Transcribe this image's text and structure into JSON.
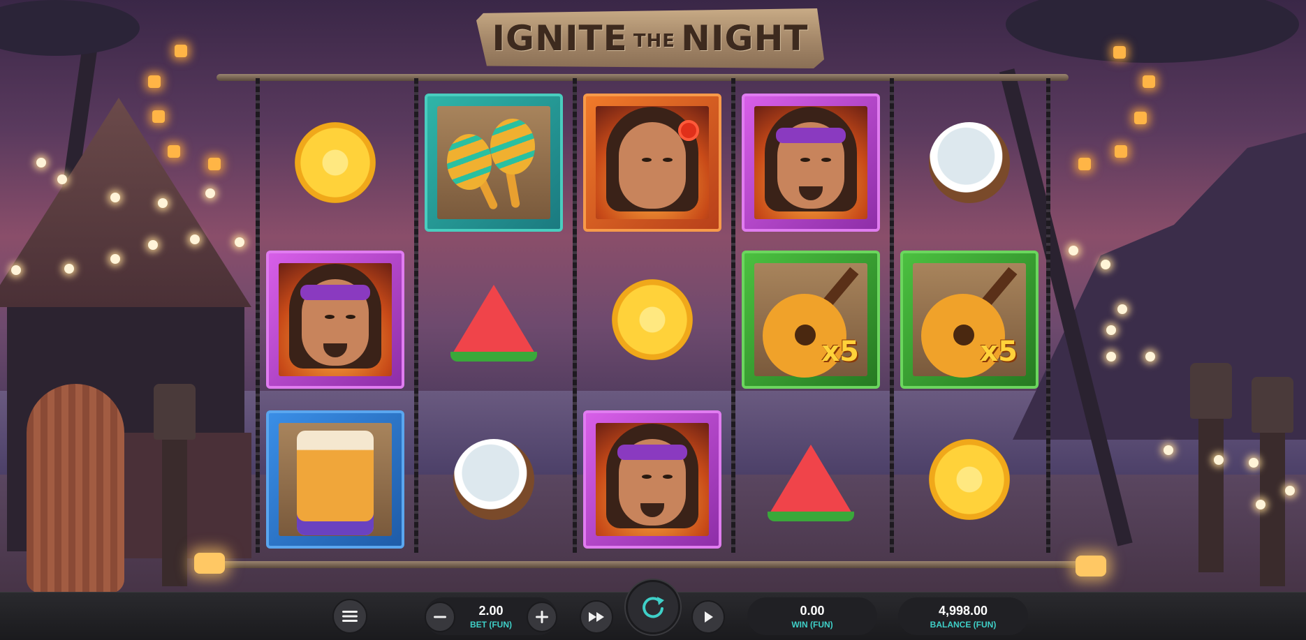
{
  "game": {
    "title_main_1": "IGNITE",
    "title_the": "THE",
    "title_main_2": "NIGHT"
  },
  "reels": [
    [
      "pineapple",
      "man-bandana",
      "drum"
    ],
    [
      "maracas",
      "watermelon",
      "coconut"
    ],
    [
      "woman-flower",
      "pineapple",
      "man-bandana"
    ],
    [
      "man-bandana",
      "guitar-x5",
      "watermelon"
    ],
    [
      "coconut",
      "guitar-x5",
      "pineapple"
    ]
  ],
  "symbols": {
    "guitar_multiplier": "x5"
  },
  "controls": {
    "menu_icon": "hamburger-icon",
    "bet_value": "2.00",
    "bet_label": "BET (FUN)",
    "minus_icon": "minus-icon",
    "plus_icon": "plus-icon",
    "turbo_icon": "fast-forward-icon",
    "spin_icon": "refresh-icon",
    "autoplay_icon": "play-icon",
    "win_value": "0.00",
    "win_label": "WIN (FUN)",
    "balance_value": "4,998.00",
    "balance_label": "BALANCE (FUN)",
    "accent_color": "#3fd0c8"
  }
}
